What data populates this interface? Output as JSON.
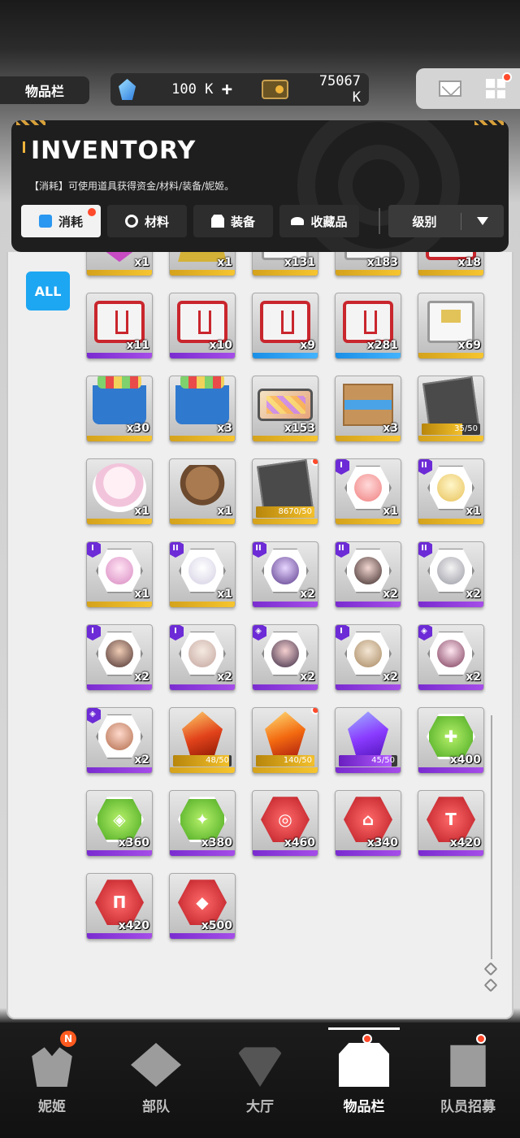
{
  "header": {
    "title": "物品栏",
    "currency": {
      "gem_amount": "100 K",
      "plus_label": "+",
      "credit_amount": "75067 K"
    }
  },
  "inventory": {
    "title": "INVENTORY",
    "description": "【消耗】可使用道具获得资金/材料/装备/妮姬。",
    "tabs": [
      {
        "label": "消耗",
        "icon": "consumable-icon",
        "active": true,
        "has_dot": true
      },
      {
        "label": "材料",
        "icon": "material-icon",
        "active": false,
        "has_dot": false
      },
      {
        "label": "装备",
        "icon": "equipment-icon",
        "active": false,
        "has_dot": false
      },
      {
        "label": "收藏品",
        "icon": "collection-icon",
        "active": false,
        "has_dot": false
      }
    ],
    "sort": {
      "label": "级别",
      "icon": "chevron-down-icon"
    },
    "filter_all": "ALL"
  },
  "items": [
    {
      "name": "pink-crate",
      "visual": "ribbon",
      "rarity": "gold",
      "count": "x1"
    },
    {
      "name": "gold-crate",
      "visual": "trophy",
      "rarity": "gold",
      "count": "x1"
    },
    {
      "name": "white-box",
      "visual": "box-white",
      "rarity": "gold",
      "count": "x131"
    },
    {
      "name": "white-box-2",
      "visual": "box-white",
      "rarity": "gold",
      "count": "x183"
    },
    {
      "name": "red-box",
      "visual": "box-red",
      "rarity": "gold",
      "count": "x18"
    },
    {
      "name": "red-box-2",
      "visual": "box-red",
      "rarity": "purple",
      "count": "x11"
    },
    {
      "name": "red-box-3",
      "visual": "box-red",
      "rarity": "purple",
      "count": "x10"
    },
    {
      "name": "red-box-4",
      "visual": "box-red",
      "rarity": "blue",
      "count": "x9"
    },
    {
      "name": "red-box-5",
      "visual": "box-red",
      "rarity": "blue",
      "count": "x281"
    },
    {
      "name": "white-supply-box",
      "visual": "box-white",
      "rarity": "gold",
      "count": "x69"
    },
    {
      "name": "blue-basket",
      "visual": "basket",
      "rarity": "gold",
      "count": "x30"
    },
    {
      "name": "blue-basket-2",
      "visual": "basket",
      "rarity": "gold",
      "count": "x3"
    },
    {
      "name": "jewel-case",
      "visual": "jewel-case",
      "rarity": "gold",
      "count": "x153"
    },
    {
      "name": "cardboard-box",
      "visual": "cardboard",
      "rarity": "gold",
      "count": "x3"
    },
    {
      "name": "photo-frame",
      "visual": "card-dark",
      "rarity": "gold",
      "progress": "35/50",
      "progress_value": 0.7
    },
    {
      "name": "birthday-item",
      "visual": "bday",
      "rarity": "gold",
      "count": "x1"
    },
    {
      "name": "cake-item",
      "visual": "cake",
      "rarity": "gold",
      "count": "x1"
    },
    {
      "name": "dark-card",
      "visual": "card-dark",
      "rarity": "gold",
      "progress": "8670/50",
      "progress_value": 1,
      "has_dot": true
    },
    {
      "name": "nikke-pink",
      "visual": "hex p1",
      "rarity": "gold",
      "count": "x1",
      "badge": "I"
    },
    {
      "name": "nikke-blonde",
      "visual": "hex p2",
      "rarity": "gold",
      "count": "x1",
      "badge": "II"
    },
    {
      "name": "nikke-pink-2",
      "visual": "hex p3",
      "rarity": "gold",
      "count": "x1",
      "badge": "I"
    },
    {
      "name": "nikke-white",
      "visual": "hex p4",
      "rarity": "gold",
      "count": "x1",
      "badge": "II"
    },
    {
      "name": "nikke-purple",
      "visual": "hex p5",
      "rarity": "purple",
      "count": "x2",
      "badge": "II"
    },
    {
      "name": "nikke-dark",
      "visual": "hex p6",
      "rarity": "purple",
      "count": "x2",
      "badge": "II"
    },
    {
      "name": "nikke-grey",
      "visual": "hex p7",
      "rarity": "purple",
      "count": "x2",
      "badge": "II"
    },
    {
      "name": "nikke-brown",
      "visual": "hex p8",
      "rarity": "purple",
      "count": "x2",
      "badge": "I"
    },
    {
      "name": "nikke-light",
      "visual": "hex p9",
      "rarity": "purple",
      "count": "x2",
      "badge": "I"
    },
    {
      "name": "nikke-violet",
      "visual": "hex p10",
      "rarity": "purple",
      "count": "x2",
      "badge": "◈"
    },
    {
      "name": "nikke-tan",
      "visual": "hex p11",
      "rarity": "purple",
      "count": "x2",
      "badge": "I"
    },
    {
      "name": "nikke-rose",
      "visual": "hex p12",
      "rarity": "purple",
      "count": "x2",
      "badge": "◈"
    },
    {
      "name": "nikke-peach",
      "visual": "hex p13",
      "rarity": "purple",
      "count": "x2",
      "badge": "◈"
    },
    {
      "name": "ssr-crystal",
      "visual": "crystal c-ssr",
      "rarity": "gold",
      "progress": "48/50",
      "progress_value": 0.96
    },
    {
      "name": "ssr-crystal-2",
      "visual": "crystal c-ssr2",
      "rarity": "gold",
      "progress": "140/50",
      "progress_value": 1,
      "has_dot": true
    },
    {
      "name": "purple-crystal",
      "visual": "crystal c-purple",
      "rarity": "purple",
      "progress": "45/50",
      "progress_value": 0.9,
      "progress_color": "purple"
    },
    {
      "name": "green-module",
      "visual": "mod mod-green",
      "rarity": "purple",
      "count": "x400",
      "glyph": "✚"
    },
    {
      "name": "green-module-2",
      "visual": "mod mod-green",
      "rarity": "purple",
      "count": "x360",
      "glyph": "◈"
    },
    {
      "name": "green-module-3",
      "visual": "mod mod-green",
      "rarity": "purple",
      "count": "x380",
      "glyph": "✦"
    },
    {
      "name": "red-module",
      "visual": "mod mod-red",
      "rarity": "purple",
      "count": "x460",
      "glyph": "◎"
    },
    {
      "name": "red-module-2",
      "visual": "mod mod-red",
      "rarity": "purple",
      "count": "x340",
      "glyph": "⌂"
    },
    {
      "name": "red-module-3",
      "visual": "mod mod-red",
      "rarity": "purple",
      "count": "x420",
      "glyph": "T"
    },
    {
      "name": "red-module-4",
      "visual": "mod mod-red",
      "rarity": "purple",
      "count": "x420",
      "glyph": "Π"
    },
    {
      "name": "red-module-5",
      "visual": "mod mod-red",
      "rarity": "purple",
      "count": "x500",
      "glyph": "◆"
    }
  ],
  "bottom_nav": [
    {
      "label": "妮姬",
      "icon": "nikke-icon",
      "badge": "N"
    },
    {
      "label": "部队",
      "icon": "squad-icon"
    },
    {
      "label": "大厅",
      "icon": "lobby-icon"
    },
    {
      "label": "物品栏",
      "icon": "inventory-icon",
      "active": true,
      "has_dot": true
    },
    {
      "label": "队员招募",
      "icon": "recruit-icon",
      "has_dot": true
    }
  ],
  "colors": {
    "accent_blue": "#1da6f2",
    "rarity_gold": "#f0b43a",
    "rarity_purple": "#8a3bd8",
    "rarity_blue": "#1a8fe6",
    "notification_red": "#ff4a2b"
  }
}
